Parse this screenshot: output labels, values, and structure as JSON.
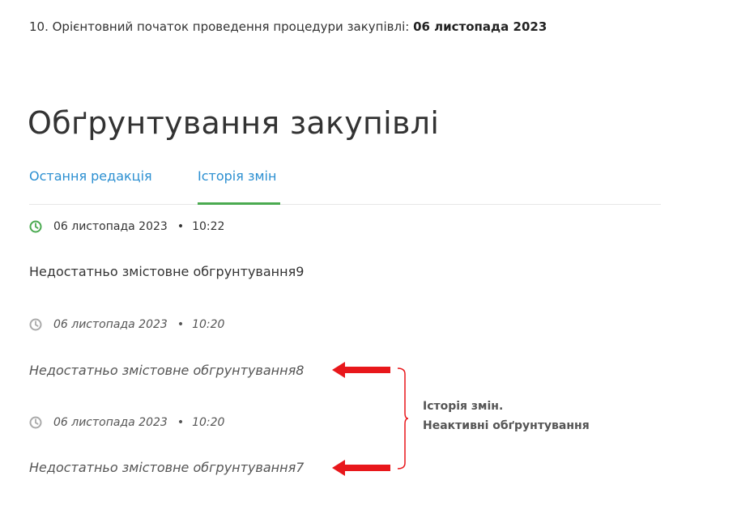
{
  "notice": {
    "text": "10. Орієнтовний початок проведення процедури закупівлі: ",
    "date": "06 листопада 2023"
  },
  "section_title": "Обґрунтування закупівлі",
  "tabs": [
    {
      "label": "Остання редакція",
      "active": false
    },
    {
      "label": "Історія змін",
      "active": true
    }
  ],
  "entries": [
    {
      "date": "06 листопада 2023",
      "separator": "•",
      "time": "10:22",
      "text": "Недостатньо змістовне обгрунтування9",
      "active": true
    },
    {
      "date": "06 листопада 2023",
      "separator": "•",
      "time": "10:20",
      "text": "Недостатньо змістовне обгрунтування8",
      "active": false
    },
    {
      "date": "06 листопада 2023",
      "separator": "•",
      "time": "10:20",
      "text": "Недостатньо змістовне обгрунтування7",
      "active": false
    }
  ],
  "annotation": {
    "line1": "Історія змін.",
    "line2": "Неактивні обґрунтування"
  },
  "colors": {
    "tab_link": "#2b8fd1",
    "tab_underline": "#4aaa50",
    "active_clock": "#4aaa50",
    "inactive_clock": "#aaaaaa",
    "arrow": "#e8171b"
  },
  "icons": {
    "clock": "clock-icon",
    "arrow": "arrow-left-icon"
  }
}
